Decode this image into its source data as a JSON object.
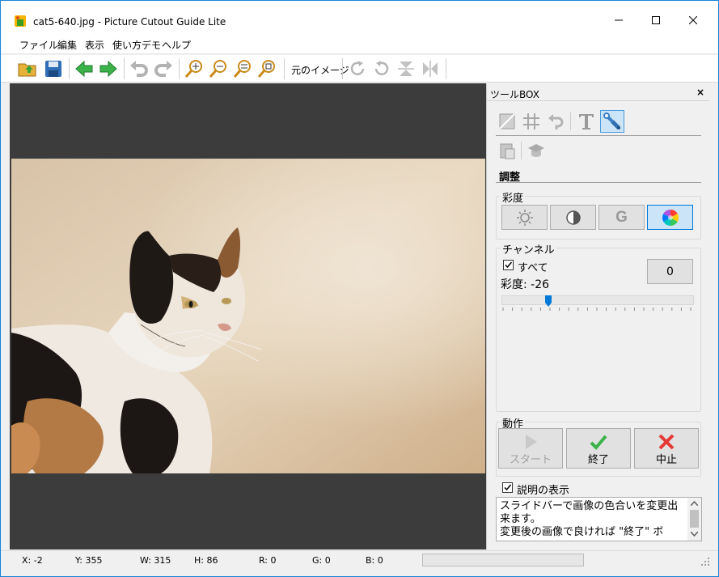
{
  "window": {
    "title": "cat5-640.jpg - Picture Cutout Guide Lite"
  },
  "menu": [
    "ファイル",
    "編集",
    "表示",
    "使い方デモ",
    "ヘルプ"
  ],
  "toolbar": {
    "original_image_label": "元のイメージ"
  },
  "toolbox": {
    "title": "ツールBOX",
    "close_label": "×",
    "section_title": "調整",
    "saturation_group": {
      "label": "彩度"
    },
    "mode_buttons": [
      {
        "name": "brightness",
        "glyph": "☼"
      },
      {
        "name": "contrast",
        "glyph": "◐"
      },
      {
        "name": "gamma",
        "glyph": "G"
      },
      {
        "name": "color",
        "glyph": ""
      }
    ],
    "channel_group": {
      "label": "チャンネル",
      "all_checkbox": "すべて",
      "value_box": "0",
      "saturation_text": "彩度: -26",
      "slider_fraction": 0.245
    },
    "action_group": {
      "label": "動作",
      "start": "スタート",
      "finish": "終了",
      "cancel": "中止"
    },
    "show_help_checkbox": "説明の表示",
    "help_text_line1": "スライドバーで画像の色合いを変更出",
    "help_text_line2": "来ます。",
    "help_text_line3": "変更後の画像で良ければ \"終了\" ボ"
  },
  "status": {
    "x": "X: -2",
    "y": "Y: 355",
    "w": "W: 315",
    "h": "H: 86",
    "r": "R: 0",
    "g": "G: 0",
    "b": "B: 0"
  },
  "colors": {
    "accent": "#0078d7",
    "canvas_bg": "#3c3c3c"
  }
}
